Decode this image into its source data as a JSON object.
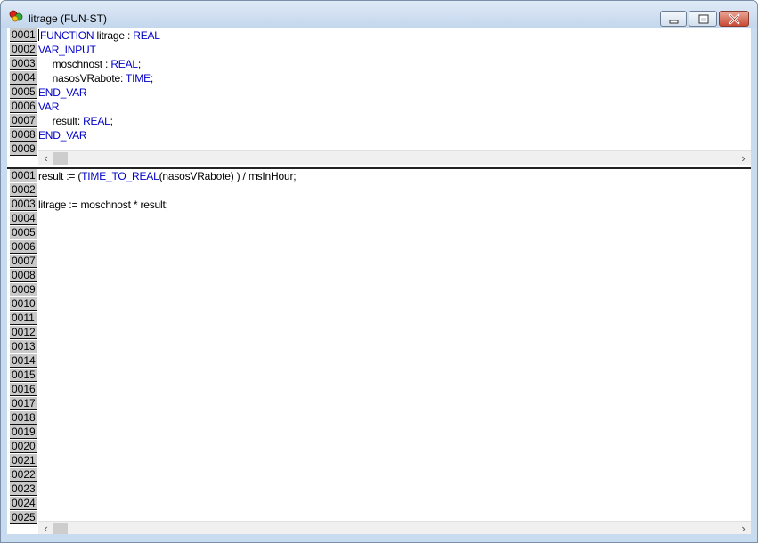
{
  "window": {
    "title": "litrage (FUN-ST)",
    "icon": "pou-icon",
    "controls": {
      "minimize": "minimize-icon",
      "maximize": "maximize-icon",
      "close": "close-icon"
    }
  },
  "declaration": {
    "line_numbers": [
      "0001",
      "0002",
      "0003",
      "0004",
      "0005",
      "0006",
      "0007",
      "0008",
      "0009"
    ],
    "lines": [
      [
        {
          "t": "FUNCTION",
          "k": true
        },
        {
          "t": " litrage : "
        },
        {
          "t": "REAL",
          "k": true
        }
      ],
      [
        {
          "t": "VAR_INPUT",
          "k": true
        }
      ],
      [
        {
          "t": "     moschnost : "
        },
        {
          "t": "REAL",
          "k": true
        },
        {
          "t": ";"
        }
      ],
      [
        {
          "t": "     nasosVRabote: "
        },
        {
          "t": "TIME",
          "k": true
        },
        {
          "t": ";"
        }
      ],
      [
        {
          "t": "END_VAR",
          "k": true
        }
      ],
      [
        {
          "t": "VAR",
          "k": true
        }
      ],
      [
        {
          "t": "     result: "
        },
        {
          "t": "REAL",
          "k": true
        },
        {
          "t": ";"
        }
      ],
      [
        {
          "t": "END_VAR",
          "k": true
        }
      ]
    ]
  },
  "body": {
    "line_numbers": [
      "0001",
      "0002",
      "0003",
      "0004",
      "0005",
      "0006",
      "0007",
      "0008",
      "0009",
      "0010",
      "0011",
      "0012",
      "0013",
      "0014",
      "0015",
      "0016",
      "0017",
      "0018",
      "0019",
      "0020",
      "0021",
      "0022",
      "0023",
      "0024",
      "0025"
    ],
    "lines": [
      [
        {
          "t": "result := ("
        },
        {
          "t": "TIME_TO_REAL",
          "k": true
        },
        {
          "t": "(nasosVRabote) ) / msInHour;"
        }
      ],
      [],
      [
        {
          "t": "litrage := moschnost * result;"
        }
      ]
    ]
  },
  "colors": {
    "keyword": "#0000c8",
    "text": "#000000",
    "gutter": "#c9c9c9"
  },
  "scrollbar": {
    "left_arrow": "‹",
    "right_arrow": "›"
  }
}
